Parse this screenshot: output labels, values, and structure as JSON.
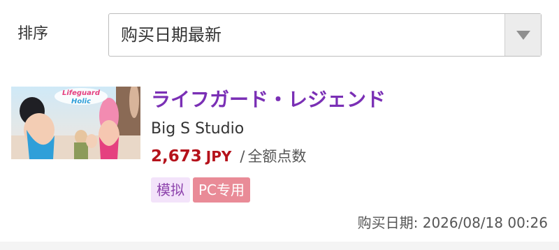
{
  "sort": {
    "label": "排序",
    "selected": "购买日期最新"
  },
  "item": {
    "thumbnail_logo": "Lifeguard Holic",
    "title": "ライフガード・レジェンド",
    "studio": "Big S Studio",
    "price": "2,673",
    "currency": "JPY",
    "separator": "/",
    "points_label": "全额点数",
    "tags": [
      "模拟",
      "PC专用"
    ],
    "purchase_date": "购买日期: 2026/08/18 00:26"
  },
  "colors": {
    "title": "#7a2fb5",
    "price": "#b5121b",
    "tag_genre_bg": "#f3e3fa",
    "tag_platform_bg": "#e98b97"
  },
  "icons": {
    "dropdown": "chevron-down-icon"
  }
}
